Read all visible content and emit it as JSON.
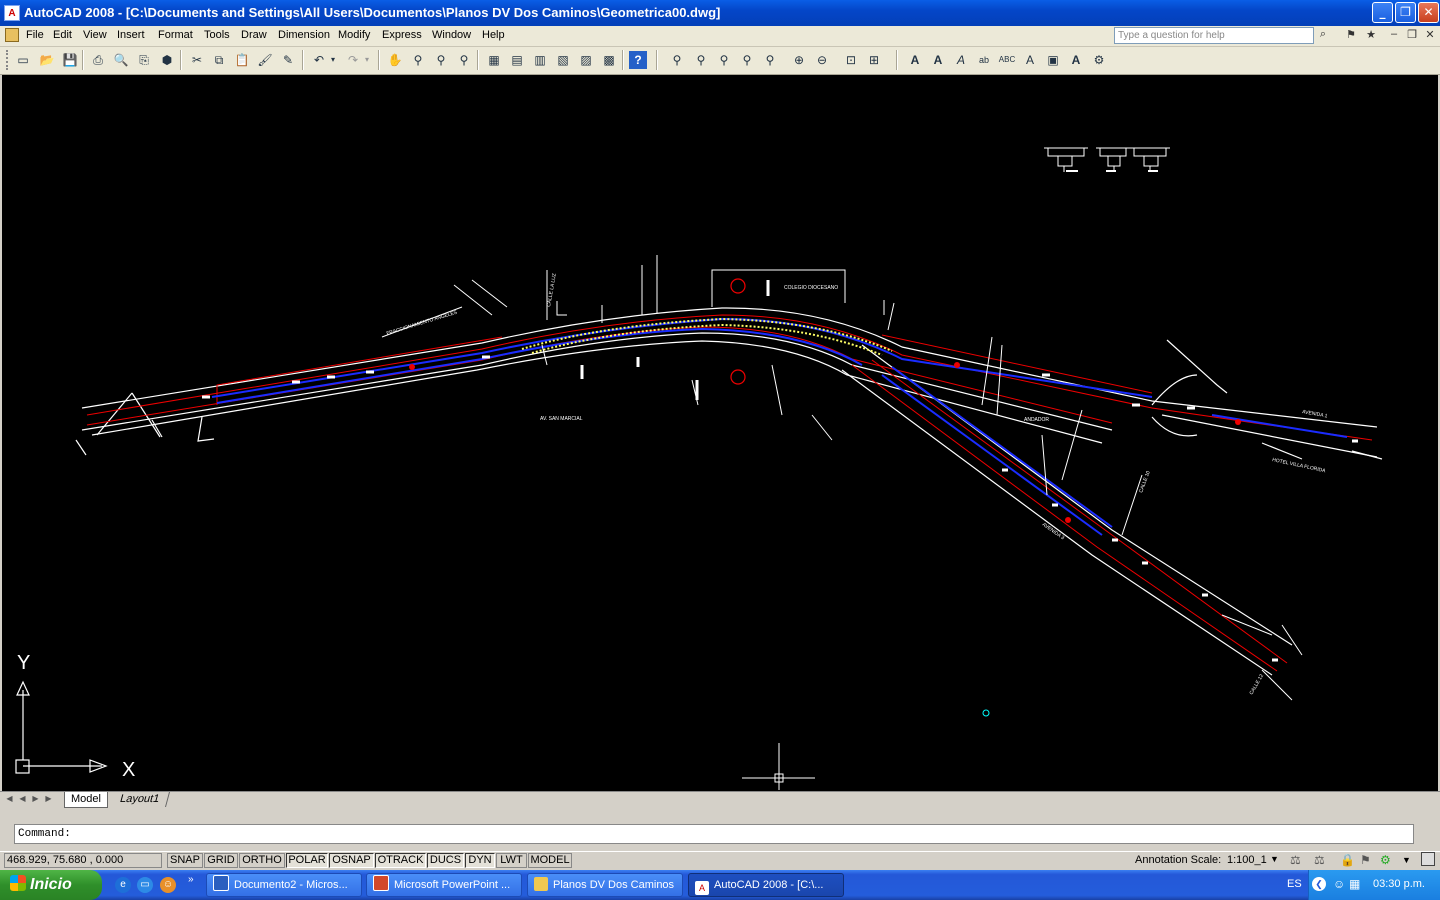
{
  "window": {
    "title": "AutoCAD 2008 - [C:\\Documents and Settings\\All Users\\Documentos\\Planos DV Dos Caminos\\Geometrica00.dwg]",
    "app_icon": "autocad-icon"
  },
  "menu": {
    "items": [
      "File",
      "Edit",
      "View",
      "Insert",
      "Format",
      "Tools",
      "Draw",
      "Dimension",
      "Modify",
      "Express",
      "Window",
      "Help"
    ]
  },
  "help": {
    "placeholder": "Type a question for help"
  },
  "toolbar": {
    "icons": [
      "new",
      "open",
      "save",
      "plot",
      "plot-preview",
      "publish",
      "3d-publish",
      "cut",
      "copy",
      "paste",
      "match-properties",
      "block-editor",
      "undo",
      "redo",
      "pan",
      "zoom-realtime",
      "zoom-window",
      "zoom-previous",
      "properties",
      "design-center",
      "tool-palettes",
      "sheet-set",
      "markup",
      "calculator",
      "help",
      "zoom-in-1",
      "zoom-2",
      "zoom-3",
      "zoom-4",
      "zoom-5",
      "zoom-in",
      "zoom-out",
      "zoom-all",
      "zoom-extents",
      "multiline-text",
      "text",
      "edit-text",
      "find",
      "spell",
      "scale-text",
      "justify",
      "convert",
      "text-style"
    ]
  },
  "drawing": {
    "labels": [
      "AV. SAN MARCIAL",
      "CALLE LA LUZ",
      "COLEGIO DIOCESANO",
      "HOTEL VILLA FLORIDA",
      "AVENIDA 1",
      "FRACCIONAMIENTO ANGELES",
      "CALLE 10",
      "AVENIDA 3",
      "ANDADOR",
      "CALLE 12"
    ],
    "ucs_y": "Y",
    "ucs_x": "X"
  },
  "tabs": {
    "model": "Model",
    "layout": "Layout1"
  },
  "command": {
    "prompt": "Command:"
  },
  "status": {
    "coords": "468.929, 75.680 , 0.000",
    "buttons": [
      "SNAP",
      "GRID",
      "ORTHO",
      "POLAR",
      "OSNAP",
      "OTRACK",
      "DUCS",
      "DYN",
      "LWT",
      "MODEL"
    ],
    "annotation_label": "Annotation Scale:",
    "annotation_value": "1:100_1"
  },
  "taskbar": {
    "start": "Inicio",
    "tasks": [
      "Documento2 - Micros...",
      "Microsoft PowerPoint ...",
      "Planos DV Dos Caminos",
      "AutoCAD 2008 - [C:\\..."
    ],
    "lang": "ES",
    "time": "03:30 p.m."
  }
}
